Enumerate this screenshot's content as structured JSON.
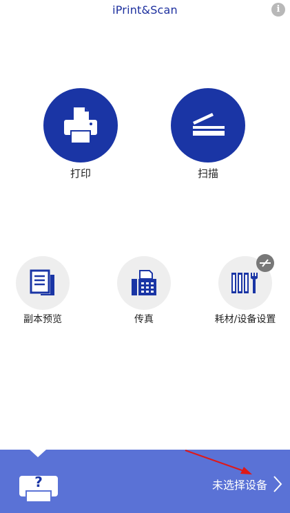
{
  "header": {
    "title": "iPrint&Scan",
    "info_glyph": "i"
  },
  "main_actions": [
    {
      "label": "打印",
      "icon": "printer-icon"
    },
    {
      "label": "扫描",
      "icon": "scanner-icon"
    }
  ],
  "secondary_actions": [
    {
      "label": "副本预览",
      "icon": "copy-preview-icon"
    },
    {
      "label": "传真",
      "icon": "fax-icon"
    },
    {
      "label": "耗材/设备设置",
      "icon": "supplies-settings-icon",
      "badge": "offline-icon"
    }
  ],
  "bottom_bar": {
    "device_icon": "unknown-printer-icon",
    "device_glyph": "?",
    "status_text": "未选择设备",
    "chevron": "chevron-right-icon"
  },
  "colors": {
    "primary": "#1a35a5",
    "bottom_bar": "#5a72d6",
    "icon_circle": "#eeeeee",
    "badge": "#787878"
  }
}
